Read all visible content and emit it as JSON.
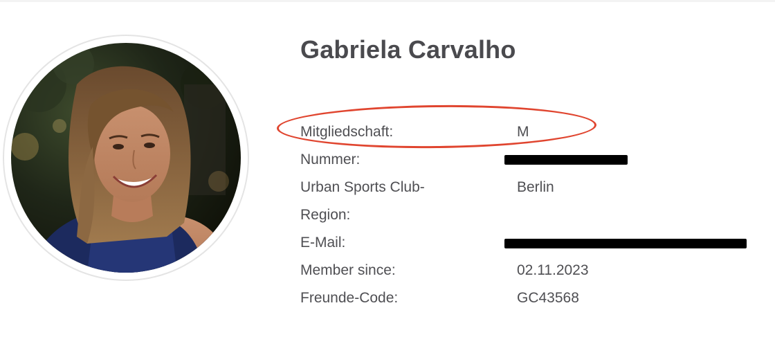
{
  "profile": {
    "name": "Gabriela Carvalho",
    "avatar_alt": "profile-photo"
  },
  "details": [
    {
      "label": "Mitgliedschaft:",
      "value": "M",
      "redacted": false
    },
    {
      "label": "Nummer:",
      "value": "",
      "redacted": true
    },
    {
      "label": "Urban Sports Club-Region:",
      "value": "Berlin",
      "redacted": false
    },
    {
      "label": "E-Mail:",
      "value": "",
      "redacted": true
    },
    {
      "label": "Member since:",
      "value": "02.11.2023",
      "redacted": false
    },
    {
      "label": "Freunde-Code:",
      "value": "GC43568",
      "redacted": false
    }
  ],
  "colors": {
    "text": "#4f4f53",
    "heading": "#4a4a4e",
    "highlight": "#e0452f",
    "redaction": "#000000"
  }
}
